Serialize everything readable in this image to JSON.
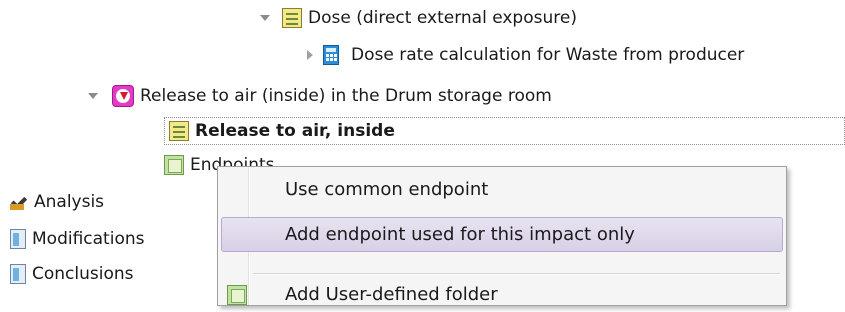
{
  "tree": {
    "dose_node": {
      "label": "Dose (direct external exposure)",
      "icon": "form-icon"
    },
    "dose_rate_node": {
      "label": "Dose rate calculation for Waste from producer",
      "icon": "calculator-icon"
    },
    "release_group": {
      "label": "Release to air (inside) in the Drum storage room",
      "icon": "release-icon"
    },
    "release_item": {
      "label": "Release to air, inside",
      "icon": "form-icon"
    },
    "endpoints_node": {
      "label": "Endpoints",
      "icon": "map-icon"
    },
    "analysis": {
      "label": "Analysis",
      "icon": "checkmark-icon"
    },
    "modifications": {
      "label": "Modifications",
      "icon": "document-icon"
    },
    "conclusions": {
      "label": "Conclusions",
      "icon": "document-icon"
    }
  },
  "context_menu": {
    "items": [
      {
        "label": "Use common endpoint"
      },
      {
        "label": "Add endpoint used for this impact only"
      },
      {
        "label": "Add User-defined folder",
        "icon": "folder-map-icon"
      }
    ]
  },
  "colors": {
    "menu_hover": "#ddd5ea",
    "selection_border": "#8c8c8c"
  }
}
